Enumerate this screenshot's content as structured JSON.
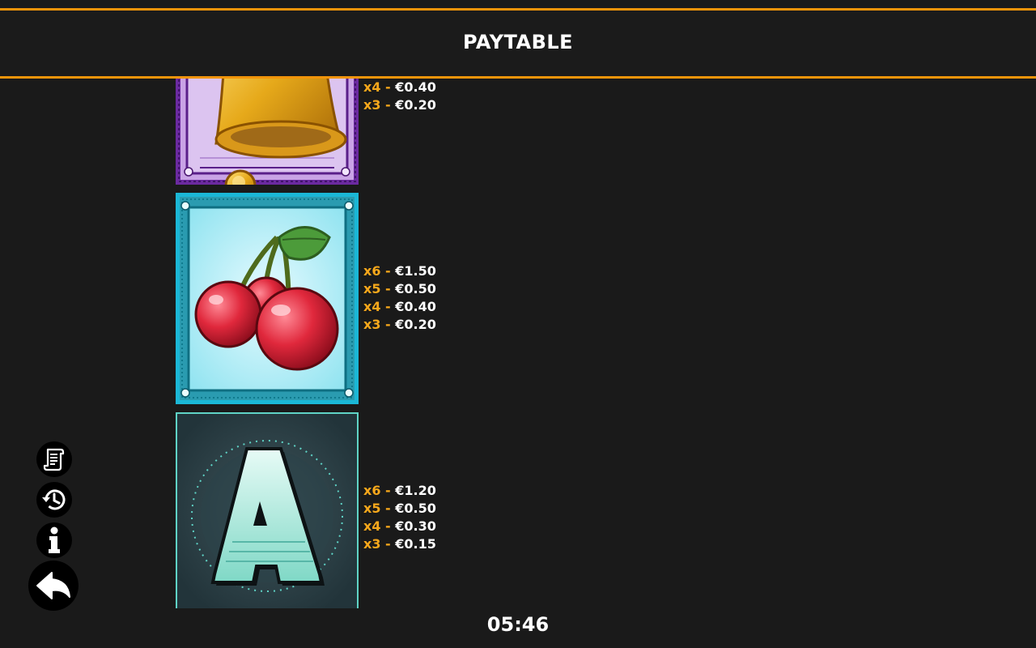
{
  "header": {
    "title": "PAYTABLE"
  },
  "symbols": [
    {
      "name": "bell",
      "pays": [
        {
          "mult": "x4 -",
          "amount": "€0.40"
        },
        {
          "mult": "x3 -",
          "amount": "€0.20"
        }
      ]
    },
    {
      "name": "cherries",
      "pays": [
        {
          "mult": "x6 -",
          "amount": "€1.50"
        },
        {
          "mult": "x5 -",
          "amount": "€0.50"
        },
        {
          "mult": "x4 -",
          "amount": "€0.40"
        },
        {
          "mult": "x3 -",
          "amount": "€0.20"
        }
      ]
    },
    {
      "name": "letter-a",
      "letter": "A",
      "pays": [
        {
          "mult": "x6 -",
          "amount": "€1.20"
        },
        {
          "mult": "x5 -",
          "amount": "€0.50"
        },
        {
          "mult": "x4 -",
          "amount": "€0.30"
        },
        {
          "mult": "x3 -",
          "amount": "€0.15"
        }
      ]
    }
  ],
  "side_buttons": [
    {
      "icon": "paytable-scroll-icon"
    },
    {
      "icon": "history-icon"
    },
    {
      "icon": "info-icon"
    },
    {
      "icon": "back-arrow-icon"
    }
  ],
  "footer": {
    "time": "05:46"
  },
  "colors": {
    "accent": "#f0940a",
    "multiplier": "#f7a81b",
    "background": "#1a1a1a"
  }
}
